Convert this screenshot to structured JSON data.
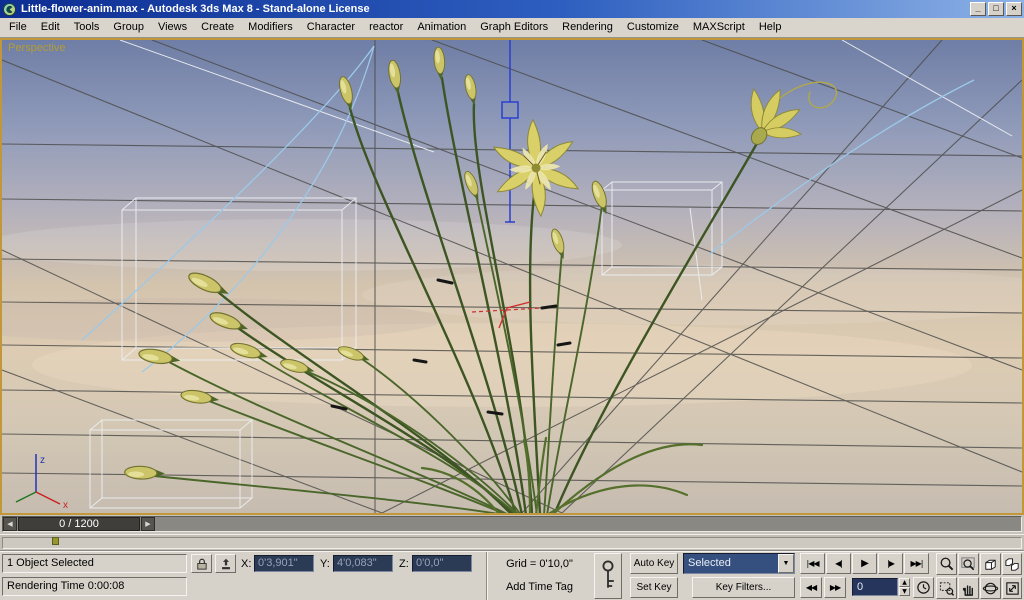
{
  "window": {
    "title": "Little-flower-anim.max - Autodesk 3ds Max 8 - Stand-alone License"
  },
  "menu": {
    "items": [
      "File",
      "Edit",
      "Tools",
      "Group",
      "Views",
      "Create",
      "Modifiers",
      "Character",
      "reactor",
      "Animation",
      "Graph Editors",
      "Rendering",
      "Customize",
      "MAXScript",
      "Help"
    ]
  },
  "viewport": {
    "label": "Perspective",
    "axis_z": "z",
    "axis_x": "x"
  },
  "time_slider": {
    "value": "0 / 1200"
  },
  "status": {
    "selection": "1 Object Selected",
    "rendering_time": "Rendering Time  0:00:08",
    "add_time_tag": "Add Time Tag",
    "x_label": "X:",
    "x_value": "0'3,901\"",
    "y_label": "Y:",
    "y_value": "4'0,083\"",
    "z_label": "Z:",
    "z_value": "0'0,0\"",
    "grid": "Grid = 0'10,0\""
  },
  "animation": {
    "auto_key": "Auto Key",
    "set_key": "Set Key",
    "selection_set": "Selected",
    "key_filters": "Key Filters...",
    "frame": "0"
  },
  "transport": {
    "go_start": "|◀◀",
    "prev_frame": "◀|",
    "play": "▶",
    "next_frame": "|▶",
    "go_end": "▶▶|",
    "prev_key": "◀◀",
    "next_key": "▶▶"
  },
  "icons": {
    "minimize": "_",
    "maximize": "□",
    "close": "×",
    "slider_prev": "◀",
    "slider_next": "▶",
    "dropdown": "▼",
    "spin_up": "▲",
    "spin_down": "▼"
  },
  "colors": {
    "active_viewport_border": "#c2973a",
    "titlebar_blue": "#2e5fc0",
    "field_navy": "#2b3a55",
    "stem_green": "#3c5522",
    "flower_yellow": "#d9d06a"
  }
}
